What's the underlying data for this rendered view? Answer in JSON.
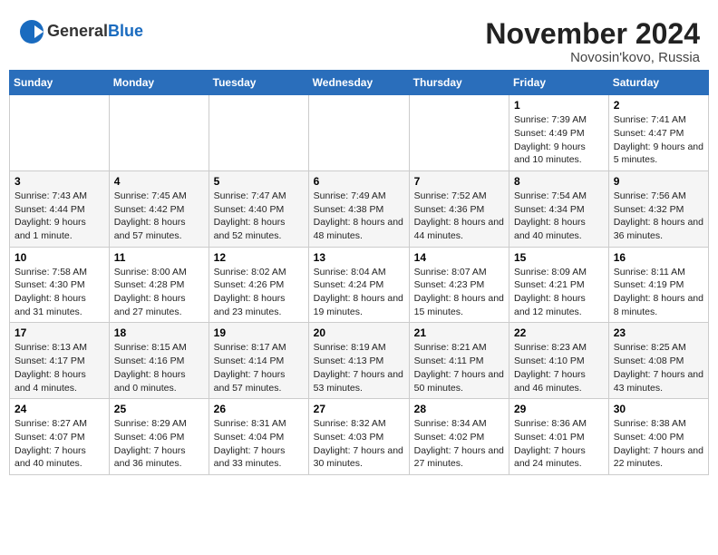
{
  "header": {
    "logo_line1": "General",
    "logo_line2": "Blue",
    "title": "November 2024",
    "subtitle": "Novosin'kovo, Russia"
  },
  "days_of_week": [
    "Sunday",
    "Monday",
    "Tuesday",
    "Wednesday",
    "Thursday",
    "Friday",
    "Saturday"
  ],
  "weeks": [
    [
      {
        "day": "",
        "sunrise": "",
        "sunset": "",
        "daylight": ""
      },
      {
        "day": "",
        "sunrise": "",
        "sunset": "",
        "daylight": ""
      },
      {
        "day": "",
        "sunrise": "",
        "sunset": "",
        "daylight": ""
      },
      {
        "day": "",
        "sunrise": "",
        "sunset": "",
        "daylight": ""
      },
      {
        "day": "",
        "sunrise": "",
        "sunset": "",
        "daylight": ""
      },
      {
        "day": "1",
        "sunrise": "Sunrise: 7:39 AM",
        "sunset": "Sunset: 4:49 PM",
        "daylight": "Daylight: 9 hours and 10 minutes."
      },
      {
        "day": "2",
        "sunrise": "Sunrise: 7:41 AM",
        "sunset": "Sunset: 4:47 PM",
        "daylight": "Daylight: 9 hours and 5 minutes."
      }
    ],
    [
      {
        "day": "3",
        "sunrise": "Sunrise: 7:43 AM",
        "sunset": "Sunset: 4:44 PM",
        "daylight": "Daylight: 9 hours and 1 minute."
      },
      {
        "day": "4",
        "sunrise": "Sunrise: 7:45 AM",
        "sunset": "Sunset: 4:42 PM",
        "daylight": "Daylight: 8 hours and 57 minutes."
      },
      {
        "day": "5",
        "sunrise": "Sunrise: 7:47 AM",
        "sunset": "Sunset: 4:40 PM",
        "daylight": "Daylight: 8 hours and 52 minutes."
      },
      {
        "day": "6",
        "sunrise": "Sunrise: 7:49 AM",
        "sunset": "Sunset: 4:38 PM",
        "daylight": "Daylight: 8 hours and 48 minutes."
      },
      {
        "day": "7",
        "sunrise": "Sunrise: 7:52 AM",
        "sunset": "Sunset: 4:36 PM",
        "daylight": "Daylight: 8 hours and 44 minutes."
      },
      {
        "day": "8",
        "sunrise": "Sunrise: 7:54 AM",
        "sunset": "Sunset: 4:34 PM",
        "daylight": "Daylight: 8 hours and 40 minutes."
      },
      {
        "day": "9",
        "sunrise": "Sunrise: 7:56 AM",
        "sunset": "Sunset: 4:32 PM",
        "daylight": "Daylight: 8 hours and 36 minutes."
      }
    ],
    [
      {
        "day": "10",
        "sunrise": "Sunrise: 7:58 AM",
        "sunset": "Sunset: 4:30 PM",
        "daylight": "Daylight: 8 hours and 31 minutes."
      },
      {
        "day": "11",
        "sunrise": "Sunrise: 8:00 AM",
        "sunset": "Sunset: 4:28 PM",
        "daylight": "Daylight: 8 hours and 27 minutes."
      },
      {
        "day": "12",
        "sunrise": "Sunrise: 8:02 AM",
        "sunset": "Sunset: 4:26 PM",
        "daylight": "Daylight: 8 hours and 23 minutes."
      },
      {
        "day": "13",
        "sunrise": "Sunrise: 8:04 AM",
        "sunset": "Sunset: 4:24 PM",
        "daylight": "Daylight: 8 hours and 19 minutes."
      },
      {
        "day": "14",
        "sunrise": "Sunrise: 8:07 AM",
        "sunset": "Sunset: 4:23 PM",
        "daylight": "Daylight: 8 hours and 15 minutes."
      },
      {
        "day": "15",
        "sunrise": "Sunrise: 8:09 AM",
        "sunset": "Sunset: 4:21 PM",
        "daylight": "Daylight: 8 hours and 12 minutes."
      },
      {
        "day": "16",
        "sunrise": "Sunrise: 8:11 AM",
        "sunset": "Sunset: 4:19 PM",
        "daylight": "Daylight: 8 hours and 8 minutes."
      }
    ],
    [
      {
        "day": "17",
        "sunrise": "Sunrise: 8:13 AM",
        "sunset": "Sunset: 4:17 PM",
        "daylight": "Daylight: 8 hours and 4 minutes."
      },
      {
        "day": "18",
        "sunrise": "Sunrise: 8:15 AM",
        "sunset": "Sunset: 4:16 PM",
        "daylight": "Daylight: 8 hours and 0 minutes."
      },
      {
        "day": "19",
        "sunrise": "Sunrise: 8:17 AM",
        "sunset": "Sunset: 4:14 PM",
        "daylight": "Daylight: 7 hours and 57 minutes."
      },
      {
        "day": "20",
        "sunrise": "Sunrise: 8:19 AM",
        "sunset": "Sunset: 4:13 PM",
        "daylight": "Daylight: 7 hours and 53 minutes."
      },
      {
        "day": "21",
        "sunrise": "Sunrise: 8:21 AM",
        "sunset": "Sunset: 4:11 PM",
        "daylight": "Daylight: 7 hours and 50 minutes."
      },
      {
        "day": "22",
        "sunrise": "Sunrise: 8:23 AM",
        "sunset": "Sunset: 4:10 PM",
        "daylight": "Daylight: 7 hours and 46 minutes."
      },
      {
        "day": "23",
        "sunrise": "Sunrise: 8:25 AM",
        "sunset": "Sunset: 4:08 PM",
        "daylight": "Daylight: 7 hours and 43 minutes."
      }
    ],
    [
      {
        "day": "24",
        "sunrise": "Sunrise: 8:27 AM",
        "sunset": "Sunset: 4:07 PM",
        "daylight": "Daylight: 7 hours and 40 minutes."
      },
      {
        "day": "25",
        "sunrise": "Sunrise: 8:29 AM",
        "sunset": "Sunset: 4:06 PM",
        "daylight": "Daylight: 7 hours and 36 minutes."
      },
      {
        "day": "26",
        "sunrise": "Sunrise: 8:31 AM",
        "sunset": "Sunset: 4:04 PM",
        "daylight": "Daylight: 7 hours and 33 minutes."
      },
      {
        "day": "27",
        "sunrise": "Sunrise: 8:32 AM",
        "sunset": "Sunset: 4:03 PM",
        "daylight": "Daylight: 7 hours and 30 minutes."
      },
      {
        "day": "28",
        "sunrise": "Sunrise: 8:34 AM",
        "sunset": "Sunset: 4:02 PM",
        "daylight": "Daylight: 7 hours and 27 minutes."
      },
      {
        "day": "29",
        "sunrise": "Sunrise: 8:36 AM",
        "sunset": "Sunset: 4:01 PM",
        "daylight": "Daylight: 7 hours and 24 minutes."
      },
      {
        "day": "30",
        "sunrise": "Sunrise: 8:38 AM",
        "sunset": "Sunset: 4:00 PM",
        "daylight": "Daylight: 7 hours and 22 minutes."
      }
    ]
  ]
}
